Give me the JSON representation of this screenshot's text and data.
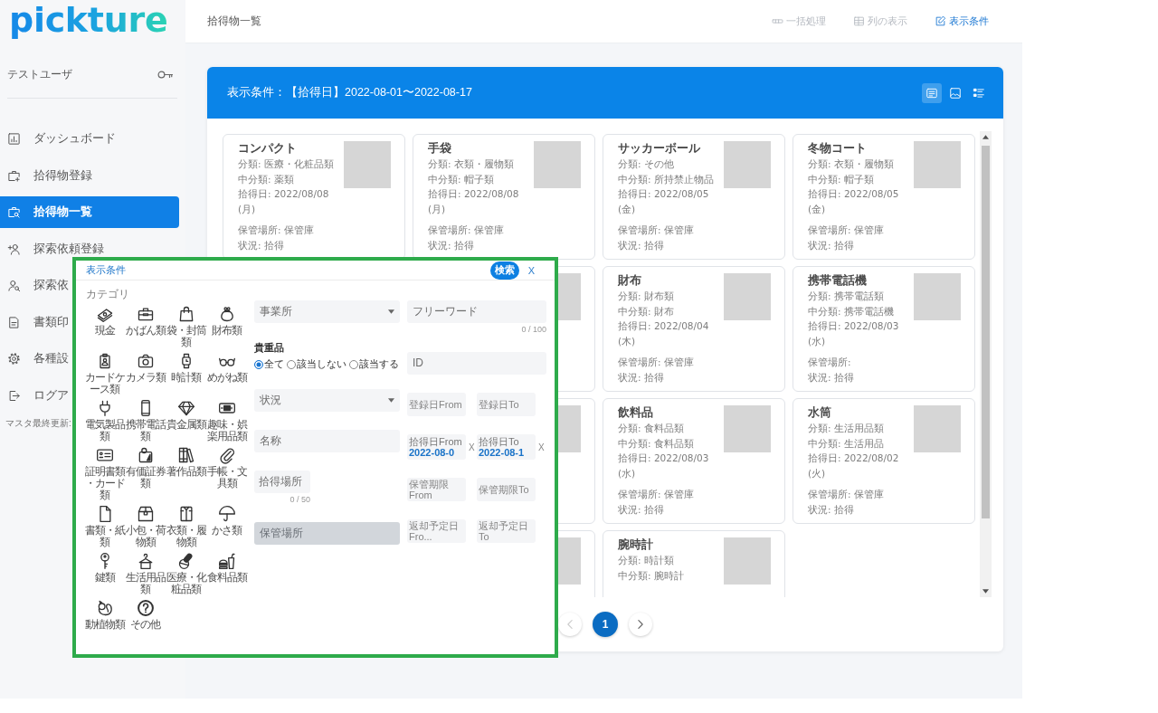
{
  "sidebar": {
    "logo": "pickture",
    "user": "テストユーザ",
    "nav": [
      {
        "label": "ダッシュボード",
        "selected": false
      },
      {
        "label": "拾得物登録",
        "selected": false
      },
      {
        "label": "拾得物一覧",
        "selected": true
      },
      {
        "label": "探索依頼登録",
        "selected": false
      },
      {
        "label": "探索依",
        "selected": false
      },
      {
        "label": "書類印",
        "selected": false
      },
      {
        "label": "各種設",
        "selected": false
      },
      {
        "label": "ログア",
        "selected": false
      }
    ],
    "footer": "マスタ最終更新:"
  },
  "header": {
    "breadcrumb": "拾得物一覧",
    "actions": [
      {
        "label": "一括処理",
        "disabled": true
      },
      {
        "label": "列の表示",
        "disabled": true
      },
      {
        "label": "表示条件",
        "disabled": false
      }
    ]
  },
  "results": {
    "banner": "表示条件：【拾得日】2022-08-01〜2022-08-17",
    "view_modes": [
      {
        "selected": true
      },
      {
        "selected": false
      },
      {
        "selected": false
      }
    ],
    "cards": [
      {
        "kind": "item",
        "name": "コンパクト",
        "category": "分類: 医療・化粧品類",
        "subcategory": "中分類: 薬類",
        "found_date": "拾得日: 2022/08/08 (月)",
        "storage": "保管場所: 保管庫",
        "status": "状況: 拾得"
      },
      {
        "kind": "item",
        "name": "手袋",
        "category": "分類: 衣類・履物類",
        "subcategory": "中分類: 帽子類",
        "found_date": "拾得日: 2022/08/08 (月)",
        "storage": "保管場所: 保管庫",
        "status": "状況: 拾得"
      },
      {
        "kind": "item",
        "name": "サッカーボール",
        "category": "分類: その他",
        "subcategory": "中分類: 所持禁止物品",
        "found_date": "拾得日: 2022/08/05 (金)",
        "storage": "保管場所: 保管庫",
        "status": "状況: 拾得"
      },
      {
        "kind": "item",
        "name": "冬物コート",
        "category": "分類: 衣類・履物類",
        "subcategory": "中分類: 帽子類",
        "found_date": "拾得日: 2022/08/05 (金)",
        "storage": "保管場所: 保管庫",
        "status": "状況: 拾得"
      },
      {
        "kind": "hidden"
      },
      {
        "kind": "covered"
      },
      {
        "kind": "item",
        "name": "財布",
        "category": "分類: 財布類",
        "subcategory": "中分類: 財布",
        "found_date": "拾得日: 2022/08/04 (木)",
        "storage": "保管場所: 保管庫",
        "status": "状況: 拾得"
      },
      {
        "kind": "item",
        "name": "携帯電話機",
        "category": "分類: 携帯電話類",
        "subcategory": "中分類: 携帯電話機",
        "found_date": "拾得日: 2022/08/03 (水)",
        "storage": "保管場所:",
        "status": "状況: 拾得"
      },
      {
        "kind": "hidden"
      },
      {
        "kind": "covered"
      },
      {
        "kind": "item",
        "name": "飲料品",
        "category": "分類: 食料品類",
        "subcategory": "中分類: 食料品類",
        "found_date": "拾得日: 2022/08/03 (水)",
        "storage": "保管場所: 保管庫",
        "status": "状況: 拾得"
      },
      {
        "kind": "item",
        "name": "水筒",
        "category": "分類: 生活用品類",
        "subcategory": "中分類: 生活用品",
        "found_date": "拾得日: 2022/08/02 (火)",
        "storage": "保管場所: 保管庫",
        "status": "状況: 拾得"
      },
      {
        "kind": "hidden"
      },
      {
        "kind": "covered"
      },
      {
        "kind": "item",
        "name": "腕時計",
        "category": "分類: 時計類",
        "subcategory": "中分類: 腕時計"
      }
    ],
    "pagination": {
      "prev": {
        "disabled": true
      },
      "pages": [
        {
          "label": "1",
          "selected": true
        }
      ],
      "next": {
        "disabled": false
      }
    }
  },
  "filter_dialog": {
    "title": "表示条件",
    "search_button": "検索",
    "close_button": "X",
    "category_heading": "カテゴリ",
    "categories": [
      {
        "label": "現金"
      },
      {
        "label": "かばん類"
      },
      {
        "label": "袋・封筒類"
      },
      {
        "label": "財布類"
      },
      {
        "label": "カードケース類"
      },
      {
        "label": "カメラ類"
      },
      {
        "label": "時計類"
      },
      {
        "label": "めがね類"
      },
      {
        "label": "電気製品類"
      },
      {
        "label": "携帯電話類"
      },
      {
        "label": "貴金属類"
      },
      {
        "label": "趣味・娯楽用品類"
      },
      {
        "label": "証明書類・カード類"
      },
      {
        "label": "有価証券類"
      },
      {
        "label": "著作品類"
      },
      {
        "label": "手帳・文具類"
      },
      {
        "label": "書類・紙類"
      },
      {
        "label": "小包・荷物類"
      },
      {
        "label": "衣類・履物類"
      },
      {
        "label": "かさ類"
      },
      {
        "label": "鍵類"
      },
      {
        "label": "生活用品類"
      },
      {
        "label": "医療・化粧品類"
      },
      {
        "label": "食料品類"
      },
      {
        "label": "動植物類"
      },
      {
        "label": "その他"
      }
    ],
    "left_fields": [
      {
        "kind": "select",
        "placeholder": "事業所",
        "disabled": false
      },
      {
        "kind": "radio_group",
        "label": "貴重品",
        "disabled": false,
        "options": [
          {
            "label": "全て",
            "selected": true
          },
          {
            "label": "該当しない",
            "selected": false
          },
          {
            "label": "該当する",
            "selected": false
          }
        ]
      },
      {
        "kind": "select",
        "placeholder": "状況",
        "disabled": false
      },
      {
        "kind": "text",
        "placeholder": "名称",
        "disabled": false
      },
      {
        "kind": "short_text",
        "placeholder": "拾得場所",
        "counter": "0 / 50",
        "disabled": false
      },
      {
        "kind": "text",
        "placeholder": "保管場所",
        "disabled": true
      }
    ],
    "right_fields": [
      {
        "kind": "text",
        "placeholder": "フリーワード",
        "counter": "0 / 100",
        "disabled": false
      },
      {
        "kind": "text",
        "placeholder": "ID",
        "disabled": false
      },
      {
        "kind": "range",
        "disabled": false,
        "from": {
          "placeholder": "登録日From"
        },
        "to": {
          "placeholder": "登録日To"
        }
      },
      {
        "kind": "range",
        "disabled": false,
        "from": {
          "label": "拾得日From",
          "value": "2022-08-0",
          "clear": "X"
        },
        "to": {
          "label": "拾得日To",
          "value": "2022-08-1",
          "clear": "X"
        }
      },
      {
        "kind": "range",
        "disabled": false,
        "from": {
          "placeholder": "保管期限From"
        },
        "to": {
          "placeholder": "保管期限To"
        }
      },
      {
        "kind": "range",
        "disabled": false,
        "from": {
          "placeholder": "返却予定日Fro..."
        },
        "to": {
          "placeholder": "返却予定日To"
        }
      }
    ]
  }
}
